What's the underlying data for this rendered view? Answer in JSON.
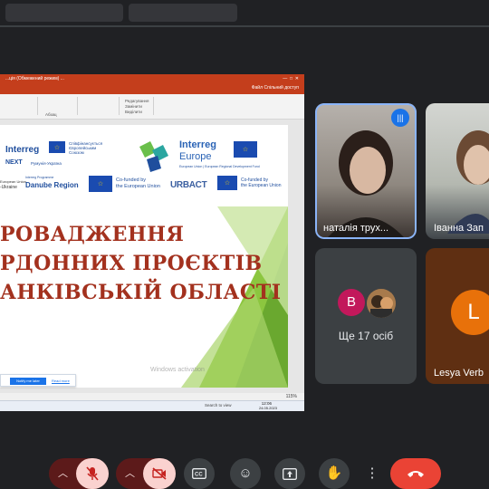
{
  "presentation": {
    "window_title": "...ція (Обмежений режим) ...",
    "ribbon_share": "Спільний доступ",
    "ribbon_file": "Файл",
    "ribbon_groups": [
      "Абзац",
      "Редагування",
      "Замінити",
      "Виділити"
    ],
    "slide": {
      "logo_interreg": "Interreg",
      "logo_next": "NEXT",
      "logo_eu_text": "Співфінансується Європейським Союзом",
      "logo_romania": "Румунія-Україна",
      "logo_interreg_europe_1": "Interreg",
      "logo_interreg_europe_2": "Europe",
      "logo_interreg_europe_sub": "European Union | European Regional Development Fund",
      "logo_ukraine": "-Ukraine",
      "logo_danube_small": "Interreg Programme",
      "logo_danube": "Danube Region",
      "logo_cofunded_1": "Co-funded by",
      "logo_cofunded_2": "the European Union",
      "logo_urbact": "URBACT",
      "logo_cofunded_3": "Co-funded by",
      "logo_cofunded_4": "the European Union",
      "logo_eu_small": "European Union",
      "line1": "РОВАДЖЕННЯ",
      "line2": "РДОННИХ ПРОЄКТІВ",
      "line3": "АНКІВСЬКІЙ ОБЛАСТІ"
    },
    "notification_primary": "Notify me later",
    "notification_secondary": "Read more",
    "watermark": "Windows activation",
    "zoom": "115%",
    "taskbar_search": "Search to view",
    "clock_time": "12:06",
    "clock_date": "24.05.2023"
  },
  "participants": [
    {
      "name": "наталія трух...",
      "speaking": true
    },
    {
      "name": "Іванна Зап"
    },
    {
      "name": "Lesya Verb",
      "initial": "L",
      "color": "#e8710a"
    }
  ],
  "more_tile": {
    "label": "Ще 17 осіб",
    "avatar_initial": "B",
    "avatar_color": "#c2185b"
  },
  "controls": {
    "mic_state": "muted",
    "camera_state": "off",
    "hangup_color": "#ea4335"
  }
}
